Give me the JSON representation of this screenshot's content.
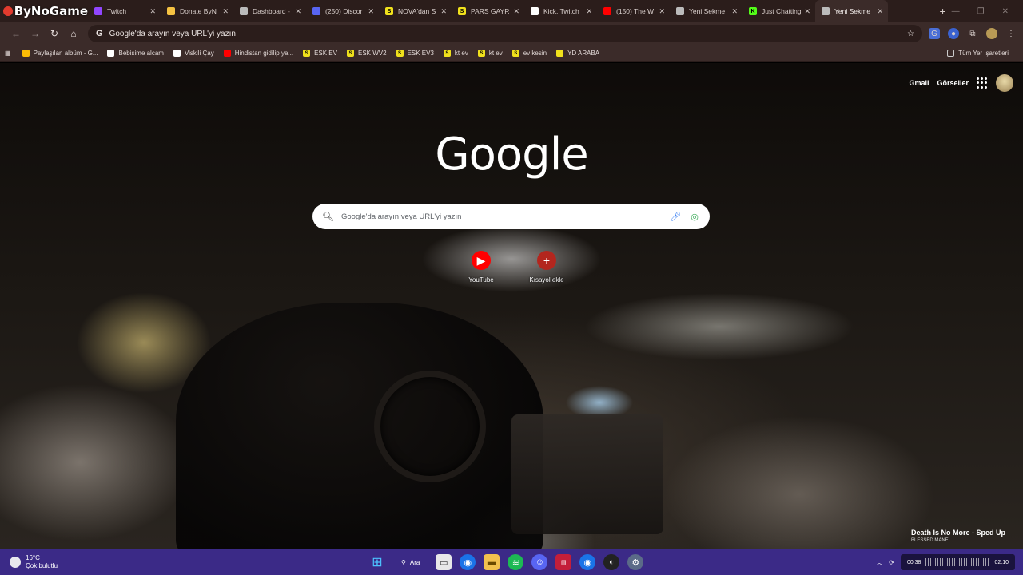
{
  "overlay": {
    "logo_text": "ByNoGame"
  },
  "tabs": [
    {
      "title": "Twitch",
      "color": "#9146ff",
      "icon": "twitch-icon"
    },
    {
      "title": "Donate ByN",
      "color": "#f5c242",
      "icon": "donate-icon"
    },
    {
      "title": "Dashboard -",
      "color": "#bbbbbb",
      "icon": "dashboard-icon"
    },
    {
      "title": "(250) Discor",
      "color": "#5865f2",
      "icon": "discord-icon"
    },
    {
      "title": "NOVA'dan S",
      "color": "#f0e11c",
      "icon": "sahibinden-icon",
      "letter": "S"
    },
    {
      "title": "PARS GAYRİ",
      "color": "#f0e11c",
      "icon": "sahibinden-icon",
      "letter": "S"
    },
    {
      "title": "Kick, Twitch",
      "color": "#ffffff",
      "icon": "kick-icon"
    },
    {
      "title": "(150) The W",
      "color": "#ff0000",
      "icon": "youtube-icon"
    },
    {
      "title": "Yeni Sekme",
      "color": "#bbbbbb",
      "icon": "chrome-icon"
    },
    {
      "title": "Just Chatting",
      "color": "#53fc18",
      "icon": "kick-icon",
      "letter": "K"
    },
    {
      "title": "Yeni Sekme",
      "color": "#bbbbbb",
      "icon": "chrome-icon",
      "active": true
    }
  ],
  "toolbar": {
    "address": "Google'da arayın veya URL'yi yazın",
    "address_prefix": "G"
  },
  "bookmarks": [
    {
      "label": "Paylaşılan albüm - G...",
      "color": "#fbbc05"
    },
    {
      "label": "Bebisime alcam",
      "color": "#ffffff"
    },
    {
      "label": "Viskili Çay",
      "color": "#ffffff"
    },
    {
      "label": "Hindistan gidilip ya...",
      "color": "#ff0000"
    },
    {
      "label": "ESK EV",
      "color": "#f0e11c",
      "letter": "S"
    },
    {
      "label": "ESK WV2",
      "color": "#f0e11c",
      "letter": "S"
    },
    {
      "label": "ESK EV3",
      "color": "#f0e11c",
      "letter": "S"
    },
    {
      "label": "kt ev",
      "color": "#f0e11c",
      "letter": "S"
    },
    {
      "label": "kt ev",
      "color": "#f0e11c",
      "letter": "S"
    },
    {
      "label": "ev kesin",
      "color": "#f0e11c",
      "letter": "S"
    },
    {
      "label": "YD ARABA",
      "color": "#f0e11c"
    }
  ],
  "bookmarks_folder": "Tüm Yer İşaretleri",
  "ntp": {
    "gmail": "Gmail",
    "images": "Görseller",
    "logo": "Google",
    "search_placeholder": "Google'da arayın veya URL'yi yazın",
    "shortcuts": [
      {
        "label": "YouTube",
        "color": "#ff0000",
        "icon": "youtube-icon",
        "glyph": "▶"
      },
      {
        "label": "Kısayol ekle",
        "color": "#b3261e",
        "icon": "plus-icon",
        "glyph": "+"
      }
    ]
  },
  "now_playing": {
    "title": "Death Is No More - Sped Up",
    "artist": "BLESSED MANE"
  },
  "taskbar": {
    "temperature": "16°C",
    "weather": "Çok bulutlu",
    "search_label": "Ara",
    "media_elapsed": "00:38",
    "media_total": "02:10"
  }
}
